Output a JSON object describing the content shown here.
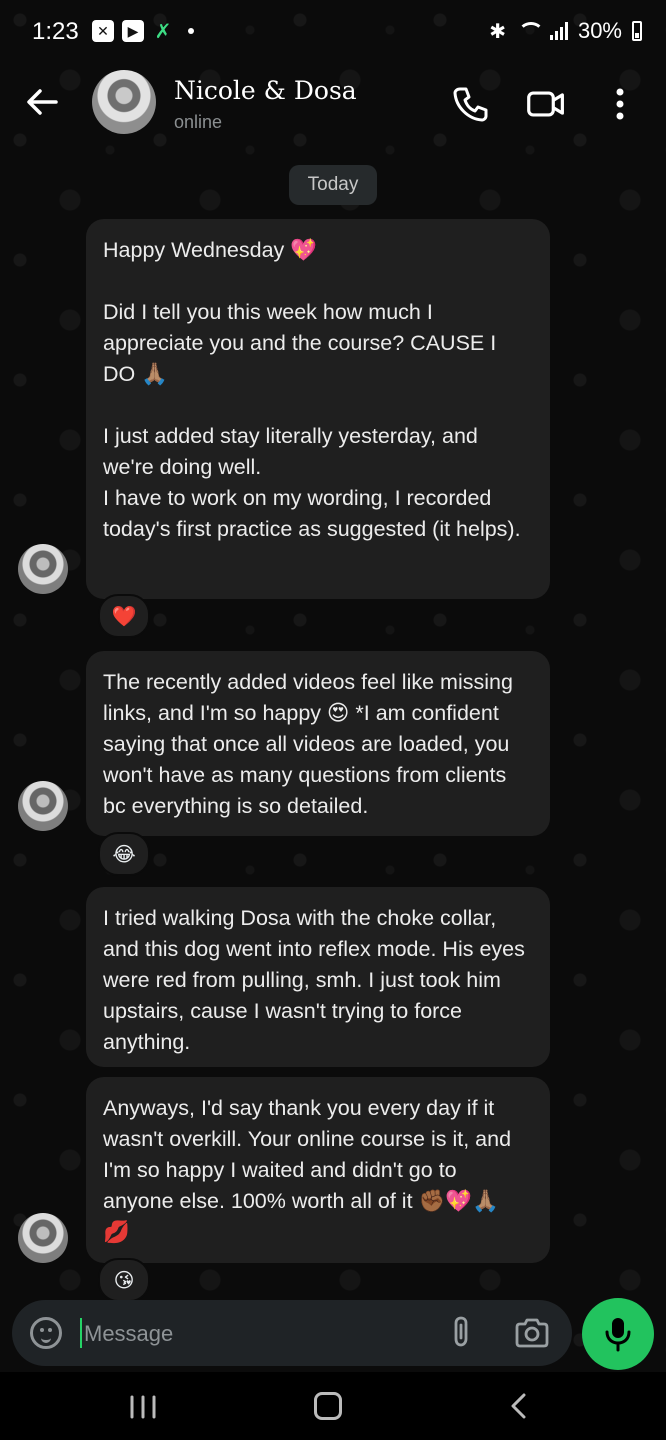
{
  "status_bar": {
    "time": "1:23",
    "battery": "30%"
  },
  "header": {
    "title": "Nicole & Dosa",
    "subtitle": "online"
  },
  "date_chip": "Today",
  "messages": [
    {
      "text": "Happy Wednesday 💖\n\nDid I tell you this week how much I appreciate you and the course? CAUSE I DO 🙏🏽\n\nI just added stay literally yesterday, and we're doing well.\nI have to work on my wording, I recorded today's first practice as suggested (it helps).",
      "reaction": "❤️"
    },
    {
      "text": "The recently added videos feel like missing links, and I'm so happy 😍 *I am confident saying that once all videos are loaded, you won't have as many questions from clients bc everything is so detailed.",
      "reaction": "😂"
    },
    {
      "text": "I tried walking Dosa with the choke collar, and this dog went into reflex mode. His eyes were red from pulling, smh. I just took him upstairs, cause I wasn't trying to force anything.",
      "reaction": ""
    },
    {
      "text": "Anyways, I'd say thank you every day if it wasn't overkill. Your online course is it, and I'm so happy I waited and didn't go to anyone else. 100% worth all of it ✊🏾💖🙏🏽\n💋",
      "reaction": "😘"
    }
  ],
  "composer": {
    "placeholder": "Message"
  },
  "colors": {
    "accent": "#22c35e",
    "bubble": "#1f1f1f",
    "background": "#0b0b0b"
  }
}
